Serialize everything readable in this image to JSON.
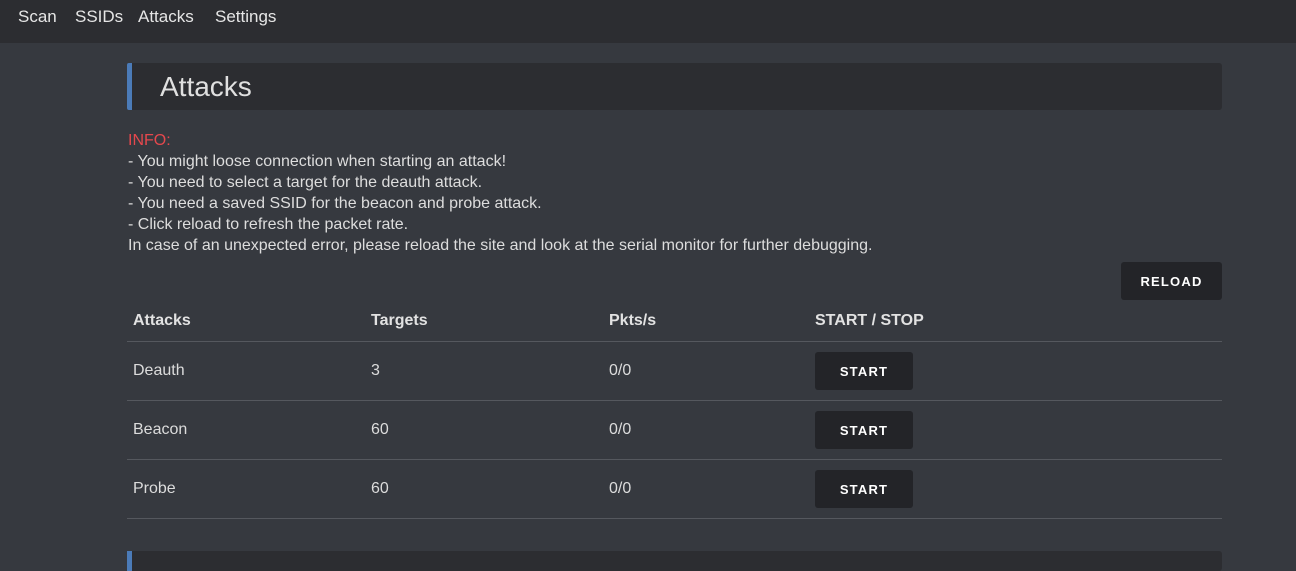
{
  "nav": {
    "items": [
      {
        "label": "Scan"
      },
      {
        "label": "SSIDs"
      },
      {
        "label": "Attacks"
      },
      {
        "label": "Settings"
      }
    ]
  },
  "header": {
    "title": "Attacks"
  },
  "info": {
    "label": "INFO:",
    "lines": [
      "- You might loose connection when starting an attack!",
      "- You need to select a target for the deauth attack.",
      "- You need a saved SSID for the beacon and probe attack.",
      "- Click reload to refresh the packet rate.",
      "In case of an unexpected error, please reload the site and look at the serial monitor for further debugging."
    ]
  },
  "reload_label": "RELOAD",
  "table": {
    "headers": [
      "Attacks",
      "Targets",
      "Pkts/s",
      "START / STOP"
    ],
    "rows": [
      {
        "attack": "Deauth",
        "targets": "3",
        "pkts": "0/0",
        "button": "START"
      },
      {
        "attack": "Beacon",
        "targets": "60",
        "pkts": "0/0",
        "button": "START"
      },
      {
        "attack": "Probe",
        "targets": "60",
        "pkts": "0/0",
        "button": "START"
      }
    ]
  },
  "colors": {
    "background": "#36393f",
    "panel": "#2c2d31",
    "accent": "#4b7bb8",
    "info_label": "#e5484d"
  }
}
